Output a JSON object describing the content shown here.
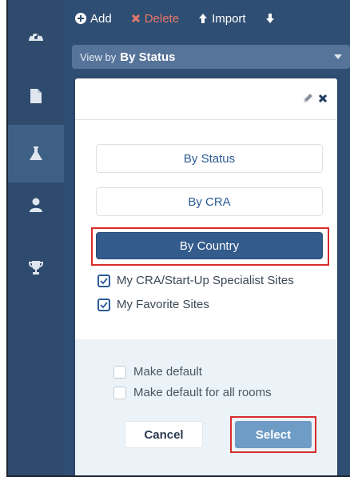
{
  "toolbar": {
    "add_label": "Add",
    "delete_label": "Delete",
    "import_label": "Import"
  },
  "view_by": {
    "prefix": "View by",
    "value": "By Status"
  },
  "sidebar": {
    "items": [
      {
        "icon": "dashboard-icon",
        "active": false
      },
      {
        "icon": "document-icon",
        "active": false
      },
      {
        "icon": "flask-icon",
        "active": true
      },
      {
        "icon": "user-icon",
        "active": false
      },
      {
        "icon": "trophy-icon",
        "active": false
      }
    ]
  },
  "panel": {
    "options": [
      {
        "label": "By Status",
        "selected": false
      },
      {
        "label": "By CRA",
        "selected": false
      },
      {
        "label": "By Country",
        "selected": true
      }
    ],
    "filters": [
      {
        "label": "My CRA/Start-Up Specialist Sites",
        "checked": true
      },
      {
        "label": "My Favorite Sites",
        "checked": true
      }
    ],
    "defaults": [
      {
        "label": "Make default",
        "checked": false
      },
      {
        "label": "Make default for all rooms",
        "checked": false
      }
    ],
    "cancel_label": "Cancel",
    "select_label": "Select"
  },
  "colors": {
    "sidebar": "#2e4a6d",
    "accent": "#335b8c",
    "delete": "#e77868",
    "highlight": "#d82c2c",
    "select_button": "#6f9bc7",
    "footer": "#ebf3f8"
  }
}
